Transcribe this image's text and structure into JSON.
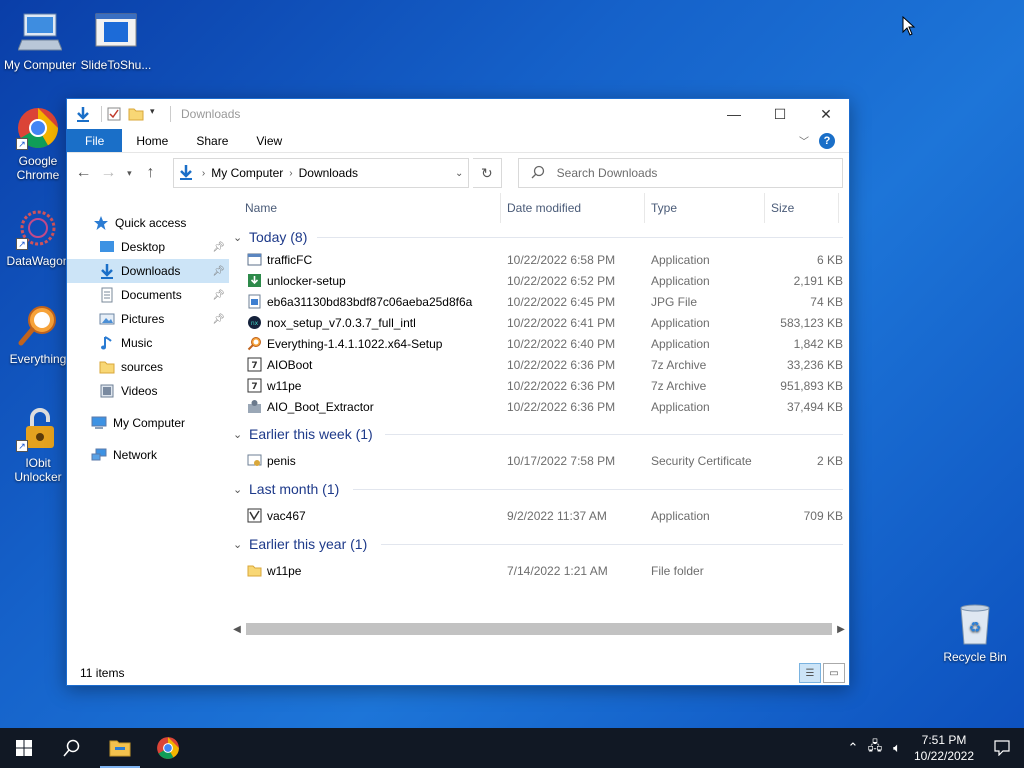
{
  "desktop": {
    "icons": [
      {
        "label": "My Computer",
        "icon": "computer-icon"
      },
      {
        "label": "SlideToShu...",
        "icon": "slide-to-shutdown-icon"
      },
      {
        "label": "Google Chrome",
        "icon": "chrome-icon"
      },
      {
        "label": "DataWagon",
        "icon": "datawagon-icon"
      },
      {
        "label": "Everything",
        "icon": "everything-search-icon"
      },
      {
        "label": "IObit Unlocker",
        "icon": "iobit-unlocker-icon"
      },
      {
        "label": "Recycle Bin",
        "icon": "recycle-bin-icon"
      }
    ]
  },
  "window": {
    "title": "Downloads",
    "ribbon_tabs": [
      "File",
      "Home",
      "Share",
      "View"
    ],
    "help_label": "?",
    "address": {
      "crumbs": [
        "My Computer",
        "Downloads"
      ]
    },
    "search": {
      "placeholder": "Search Downloads"
    },
    "sidebar": [
      {
        "label": "Quick access",
        "icon": "star-icon",
        "pinned": false
      },
      {
        "label": "Desktop",
        "icon": "desktop-folder-icon",
        "pinned": true
      },
      {
        "label": "Downloads",
        "icon": "download-folder-icon",
        "pinned": true,
        "selected": true
      },
      {
        "label": "Documents",
        "icon": "documents-folder-icon",
        "pinned": true
      },
      {
        "label": "Pictures",
        "icon": "pictures-folder-icon",
        "pinned": true
      },
      {
        "label": "Music",
        "icon": "music-folder-icon",
        "pinned": false
      },
      {
        "label": "sources",
        "icon": "folder-icon",
        "pinned": false
      },
      {
        "label": "Videos",
        "icon": "videos-folder-icon",
        "pinned": false
      },
      {
        "label": "My Computer",
        "icon": "computer-icon",
        "pinned": false
      },
      {
        "label": "Network",
        "icon": "network-icon",
        "pinned": false
      }
    ],
    "columns": [
      "Name",
      "Date modified",
      "Type",
      "Size"
    ],
    "groups": [
      {
        "label": "Today (8)",
        "files": [
          {
            "name": "trafficFC",
            "date": "10/22/2022 6:58 PM",
            "type": "Application",
            "size": "6 KB",
            "icon": "app-icon"
          },
          {
            "name": "unlocker-setup",
            "date": "10/22/2022 6:52 PM",
            "type": "Application",
            "size": "2,191 KB",
            "icon": "installer-icon"
          },
          {
            "name": "eb6a31130bd83bdf87c06aeba25d8f6a",
            "date": "10/22/2022 6:45 PM",
            "type": "JPG File",
            "size": "74 KB",
            "icon": "image-file-icon"
          },
          {
            "name": "nox_setup_v7.0.3.7_full_intl",
            "date": "10/22/2022 6:41 PM",
            "type": "Application",
            "size": "583,123 KB",
            "icon": "nox-icon"
          },
          {
            "name": "Everything-1.4.1.1022.x64-Setup",
            "date": "10/22/2022 6:40 PM",
            "type": "Application",
            "size": "1,842 KB",
            "icon": "everything-search-icon"
          },
          {
            "name": "AIOBoot",
            "date": "10/22/2022 6:36 PM",
            "type": "7z Archive",
            "size": "33,236 KB",
            "icon": "archive-icon"
          },
          {
            "name": "w11pe",
            "date": "10/22/2022 6:36 PM",
            "type": "7z Archive",
            "size": "951,893 KB",
            "icon": "archive-icon"
          },
          {
            "name": "AIO_Boot_Extractor",
            "date": "10/22/2022 6:36 PM",
            "type": "Application",
            "size": "37,494 KB",
            "icon": "extractor-icon"
          }
        ]
      },
      {
        "label": "Earlier this week (1)",
        "files": [
          {
            "name": "penis",
            "date": "10/17/2022 7:58 PM",
            "type": "Security Certificate",
            "size": "2 KB",
            "icon": "certificate-icon"
          }
        ]
      },
      {
        "label": "Last month (1)",
        "files": [
          {
            "name": "vac467",
            "date": "9/2/2022 11:37 AM",
            "type": "Application",
            "size": "709 KB",
            "icon": "app-icon"
          }
        ]
      },
      {
        "label": "Earlier this year (1)",
        "files": [
          {
            "name": "w11pe",
            "date": "7/14/2022 1:21 AM",
            "type": "File folder",
            "size": "",
            "icon": "folder-icon"
          }
        ]
      }
    ],
    "status": "11 items"
  },
  "taskbar": {
    "time": "7:51 PM",
    "date": "10/22/2022"
  },
  "colors": {
    "accent": "#1a6fc8",
    "selection": "#cce4f7",
    "taskbar": "#111824",
    "group_text": "#1e3a8a"
  }
}
